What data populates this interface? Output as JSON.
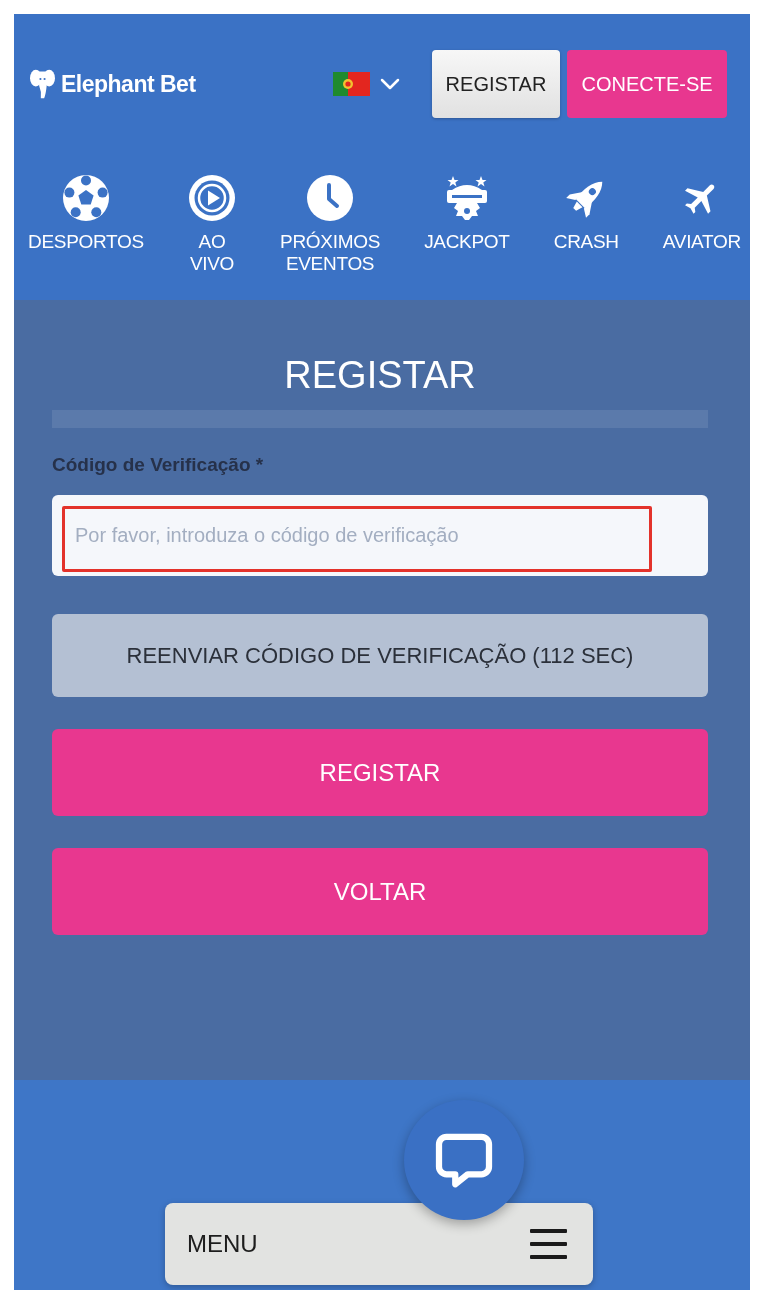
{
  "header": {
    "logo": "Elephant Bet",
    "buttons": [
      {
        "label": "REGISTAR",
        "kind": "light"
      },
      {
        "label": "CONECTE-SE",
        "kind": "primary"
      }
    ]
  },
  "nav": [
    {
      "label": "DESPORTOS"
    },
    {
      "label": "AO VIVO"
    },
    {
      "label": "PRÓXIMOS EVENTOS"
    },
    {
      "label": "JACKPOT"
    },
    {
      "label": "CRASH"
    },
    {
      "label": "AVIATOR"
    }
  ],
  "form": {
    "title": "REGISTAR",
    "field": {
      "label": "Código de Verificação *",
      "placeholder": "Por favor, introduza o código de verificação",
      "highlighted": true
    },
    "resend": {
      "label": "REENVIAR CÓDIGO DE VERIFICAÇÃO (112 SEC)",
      "disabled": true
    },
    "buttons": [
      {
        "label": "REGISTAR"
      },
      {
        "label": "VOLTAR"
      }
    ]
  },
  "footer": {
    "menu_label": "MENU"
  }
}
